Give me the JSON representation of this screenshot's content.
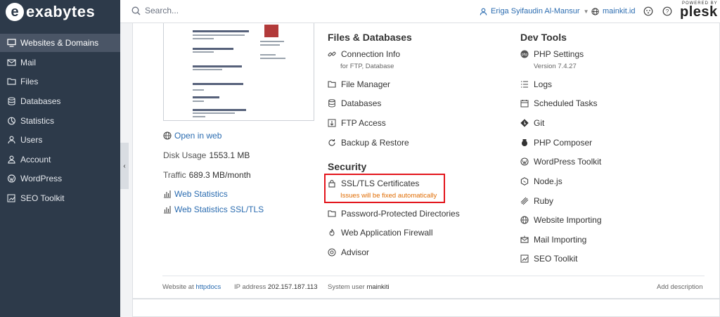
{
  "app": {
    "brand": "exabytes",
    "brand_letter": "e",
    "powered_by": "POWERED BY",
    "vendor": "plesk"
  },
  "header": {
    "search_placeholder": "Search...",
    "user_name": "Eriga Syifaudin Al-Mansur",
    "domain": "mainkit.id"
  },
  "sidebar": {
    "items": [
      {
        "label": "Websites & Domains",
        "icon": "monitor-icon",
        "active": true
      },
      {
        "label": "Mail",
        "icon": "mail-icon"
      },
      {
        "label": "Files",
        "icon": "file-icon"
      },
      {
        "label": "Databases",
        "icon": "database-icon"
      },
      {
        "label": "Statistics",
        "icon": "stats-icon"
      },
      {
        "label": "Users",
        "icon": "user-icon"
      },
      {
        "label": "Account",
        "icon": "account-icon"
      },
      {
        "label": "WordPress",
        "icon": "wordpress-icon"
      },
      {
        "label": "SEO Toolkit",
        "icon": "seo-icon"
      }
    ]
  },
  "site": {
    "open_in_web": "Open in web",
    "disk_usage_label": "Disk Usage",
    "disk_usage_value": "1553.1 MB",
    "traffic_label": "Traffic",
    "traffic_value": "689.3 MB/month",
    "web_statistics": "Web Statistics",
    "web_statistics_ssl": "Web Statistics SSL/TLS"
  },
  "files_databases": {
    "title": "Files & Databases",
    "connection_info": "Connection Info",
    "connection_info_sub": "for FTP, Database",
    "file_manager": "File Manager",
    "databases": "Databases",
    "ftp_access": "FTP Access",
    "backup_restore": "Backup & Restore"
  },
  "security": {
    "title": "Security",
    "ssl": "SSL/TLS Certificates",
    "ssl_note": "Issues will be fixed automatically",
    "password_dirs": "Password-Protected Directories",
    "waf": "Web Application Firewall",
    "advisor": "Advisor"
  },
  "dev_tools": {
    "title": "Dev Tools",
    "php_settings": "PHP Settings",
    "php_version": "Version 7.4.27",
    "logs": "Logs",
    "scheduled_tasks": "Scheduled Tasks",
    "git": "Git",
    "php_composer": "PHP Composer",
    "wordpress_toolkit": "WordPress Toolkit",
    "nodejs": "Node.js",
    "ruby": "Ruby",
    "website_importing": "Website Importing",
    "mail_importing": "Mail Importing",
    "seo_toolkit": "SEO Toolkit"
  },
  "footer": {
    "website_at_label": "Website at",
    "website_at_value": "httpdocs",
    "ip_label": "IP address",
    "ip_value": "202.157.187.113",
    "sys_user_label": "System user",
    "sys_user_value": "mainkiti",
    "add_description": "Add description"
  }
}
